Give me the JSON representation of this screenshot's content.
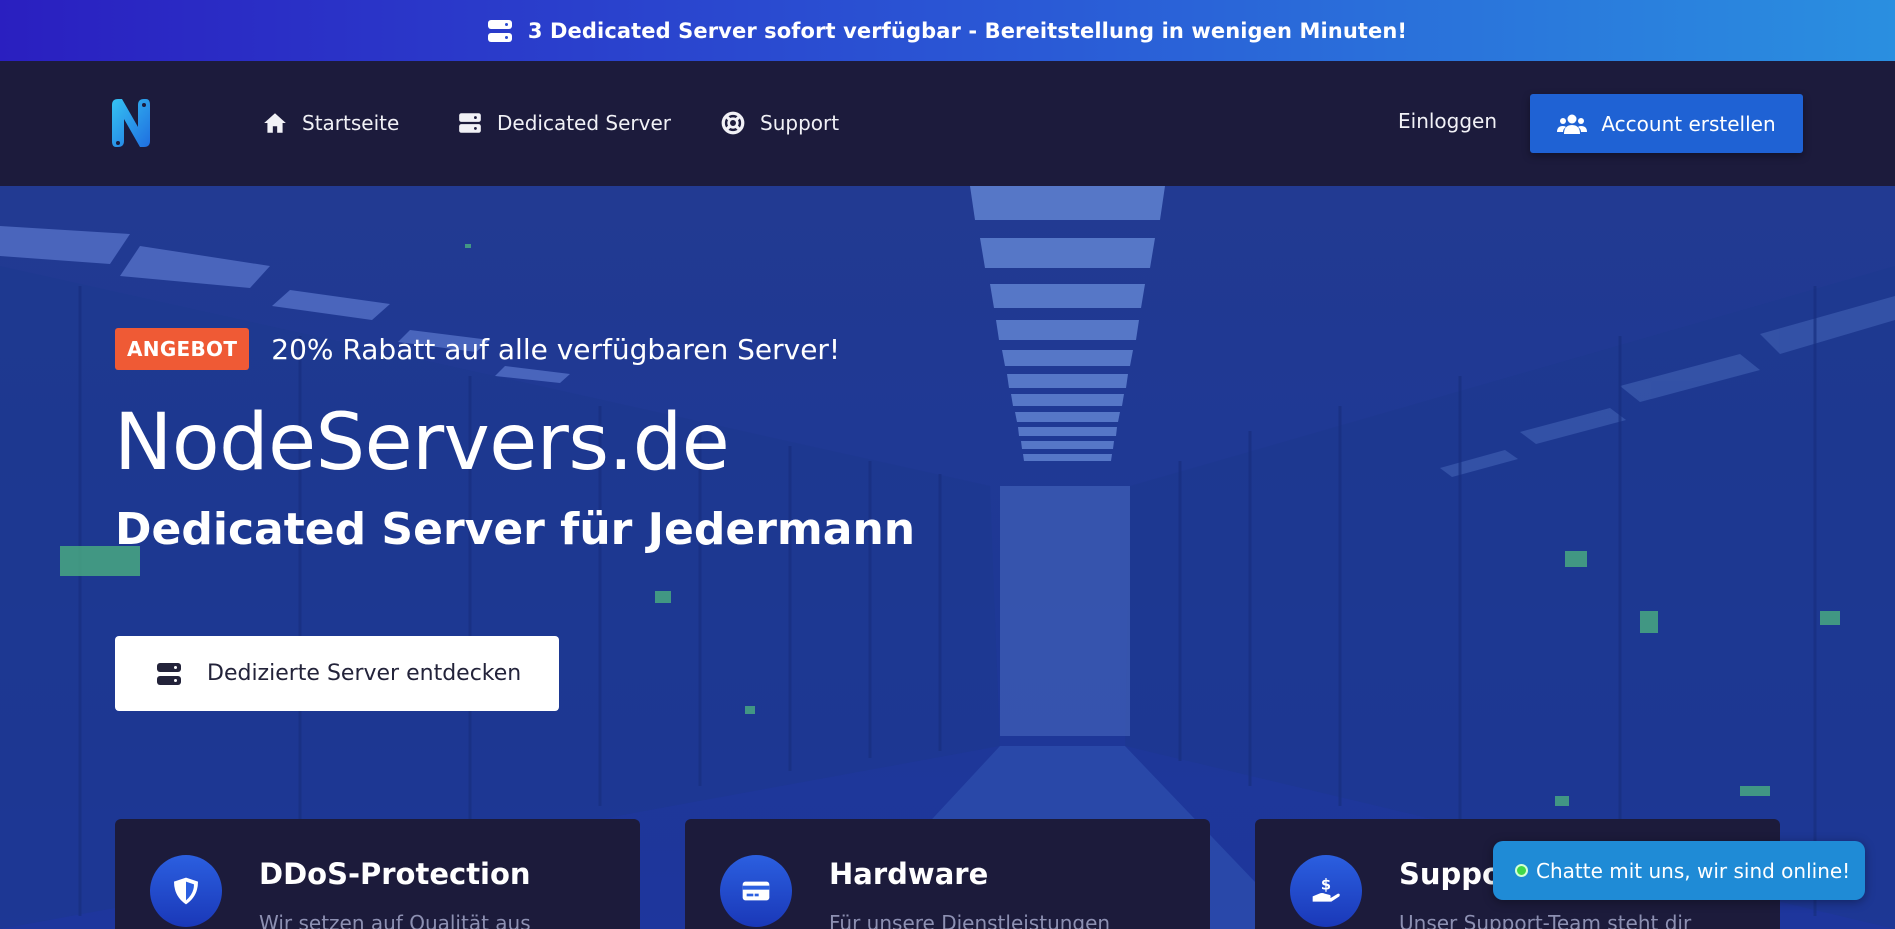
{
  "announcement": {
    "icon": "server-icon",
    "text": "3 Dedicated Server sofort verfügbar - Bereitstellung in wenigen Minuten!"
  },
  "nav": {
    "logo_letter": "N",
    "items": [
      {
        "label": "Startseite",
        "icon": "home-icon"
      },
      {
        "label": "Dedicated Server",
        "icon": "server-icon"
      },
      {
        "label": "Support",
        "icon": "lifebuoy-icon"
      }
    ],
    "login_label": "Einloggen",
    "signup_label": "Account erstellen",
    "signup_icon": "users-icon"
  },
  "hero": {
    "badge": "ANGEBOT",
    "offer_text": "20% Rabatt auf alle verfügbaren Server!",
    "title": "NodeServers.de",
    "subtitle": "Dedicated Server für Jedermann",
    "cta_label": "Dedizierte Server entdecken",
    "cta_icon": "server-icon"
  },
  "features": [
    {
      "title": "DDoS-Protection",
      "desc": "Wir setzen auf Qualität aus",
      "icon": "shield-icon"
    },
    {
      "title": "Hardware",
      "desc": "Für unsere Dienstleistungen",
      "icon": "credit-card-icon"
    },
    {
      "title": "Support",
      "desc": "Unser Support-Team steht dir",
      "icon": "hand-dollar-icon"
    }
  ],
  "chat": {
    "label": "Chatte mit uns, wir sind online!",
    "status_color": "#40d84a"
  },
  "colors": {
    "accent": "#1f62d4",
    "badge": "#ef5a35",
    "nav_bg": "#1c1b3c",
    "chat_bg": "#1f8bd6"
  }
}
